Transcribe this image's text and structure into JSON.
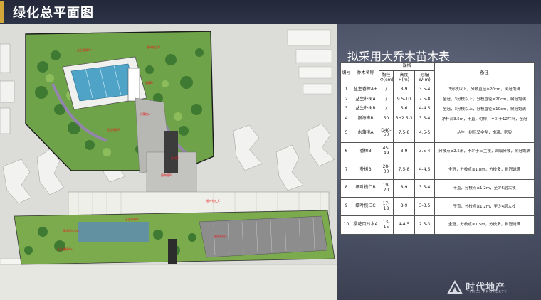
{
  "page": {
    "title": "绿化总平面图"
  },
  "table": {
    "title": "拟采用大乔木苗木表",
    "headers": {
      "no": "编号",
      "name": "乔木名称",
      "spec": "规格",
      "dbh": "胸径Φ(cm)",
      "height": "高度H(m)",
      "crown": "冠幅W(m)",
      "note": "备注"
    },
    "rows": [
      {
        "no": "1",
        "name": "丛生香樟A+",
        "dbh": "/",
        "height": "8-9",
        "crown": "3.5-4",
        "note": "3分枝以上，分枝直径≥20cm，树冠饱满"
      },
      {
        "no": "2",
        "name": "丛生朴树A",
        "dbh": "/",
        "height": "9.5-10",
        "crown": "7.5-8",
        "note": "全冠，3分枝以上，分枝直径≥20cm，树冠饱满"
      },
      {
        "no": "3",
        "name": "丛生朴树B",
        "dbh": "/",
        "height": "5-6",
        "crown": "4-4.5",
        "note": "全冠，3分枝以上，分枝直径≥10cm，树冠饱满"
      },
      {
        "no": "4",
        "name": "银海枣B",
        "dbh": "50",
        "height": "BH2.5-3",
        "crown": "3.5-4",
        "note": "净杆高3.5m，干直，匀称，不少于12片叶，全冠"
      },
      {
        "no": "5",
        "name": "水蒲桃A",
        "dbh": "D40-50",
        "height": "7.5-8",
        "crown": "4.5-5",
        "note": "丛生，树冠呈伞型，饱满，密实"
      },
      {
        "no": "6",
        "name": "香樟B",
        "dbh": "45-49",
        "height": "8-9",
        "crown": "3.5-4",
        "note": "分枝点≤2.5米，不少于三主枝，四级分枝，树冠饱满"
      },
      {
        "no": "7",
        "name": "朴树B",
        "dbh": "28-30",
        "height": "7.5-8",
        "crown": "4-4.5",
        "note": "全冠，分枝点≤1.8m，分枝多，树冠饱满"
      },
      {
        "no": "8",
        "name": "细叶榄仁B",
        "dbh": "19-20",
        "height": "8-9",
        "crown": "3.5-4",
        "note": "干直，分枝点≤1.2m，至少5层大枝"
      },
      {
        "no": "9",
        "name": "细叶榄仁C",
        "dbh": "17-18",
        "height": "8-9",
        "crown": "3-3.5",
        "note": "干直，分枝点≤1.2m，至少4层大枝"
      },
      {
        "no": "10",
        "name": "樱花风铃木A",
        "dbh": "13-15",
        "height": "4-4.5",
        "crown": "2.5-3",
        "note": "全冠，分枝点≤1.5m，分枝多，树冠饱满"
      }
    ]
  },
  "map_labels": [
    {
      "id": "lbl-1",
      "text": "细叶榄仁B"
    },
    {
      "id": "lbl-2",
      "text": "丛生香樟A+"
    },
    {
      "id": "lbl-3",
      "text": "香樟B"
    },
    {
      "id": "lbl-4",
      "text": "水蒲桃A"
    },
    {
      "id": "lbl-5",
      "text": "丛生朴树A"
    },
    {
      "id": "lbl-6",
      "text": "朴树B"
    },
    {
      "id": "lbl-7",
      "text": "银海枣B"
    },
    {
      "id": "lbl-8",
      "text": "细叶榄仁C"
    },
    {
      "id": "lbl-9",
      "text": "丛生朴树B"
    },
    {
      "id": "lbl-10",
      "text": "樱花风铃木A"
    },
    {
      "id": "lbl-11",
      "text": "丛生香樟A+"
    },
    {
      "id": "lbl-12",
      "text": "丛生朴树A"
    }
  ],
  "logo": {
    "name": "时代地产",
    "sub": "TIMES PROPERTY"
  },
  "colors": {
    "accent": "#d4a73a",
    "label_red": "#e41e1e",
    "water": "#4fa3c7",
    "lawn": "#7fb04a"
  }
}
